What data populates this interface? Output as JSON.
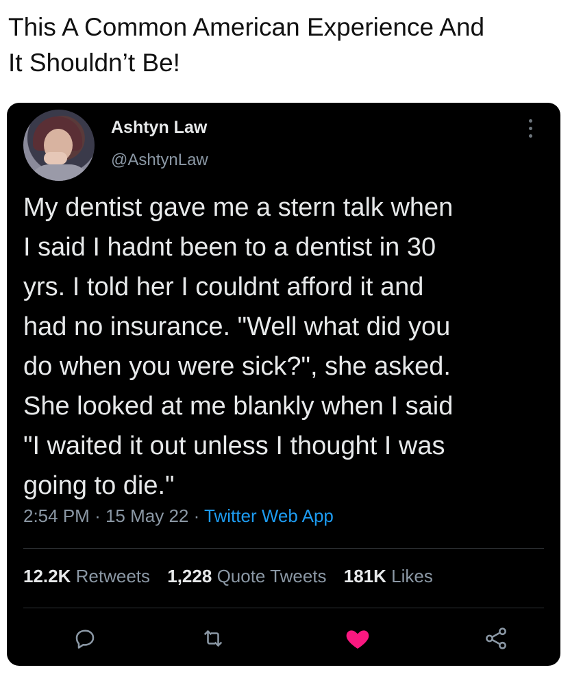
{
  "caption": {
    "line1": "This A Common American Experience And",
    "line2": "It Shouldn’t Be!"
  },
  "tweet": {
    "display_name": "Ashtyn Law",
    "handle": "@AshtynLaw",
    "text": "My dentist gave me a stern talk when\nI said I hadnt been to a dentist in 30\nyrs. I told her I couldnt afford it and\nhad no insurance. \"Well what did you\ndo when you were sick?\", she asked.\nShe looked at me blankly when I said\n\"I waited it out unless I thought I was\ngoing to die.\"",
    "time": "2:54 PM",
    "date": "15 May 22",
    "separator": "·",
    "source": "Twitter Web App"
  },
  "stats": {
    "retweets_count": "12.2K",
    "retweets_label": "Retweets",
    "quotes_count": "1,228",
    "quotes_label": "Quote Tweets",
    "likes_count": "181K",
    "likes_label": "Likes"
  },
  "icons": {
    "reply": "reply-icon",
    "retweet": "retweet-icon",
    "like": "heart-icon",
    "share": "share-icon",
    "more": "more-icon"
  },
  "colors": {
    "card_background": "#000000",
    "primary_text": "#e7e9ea",
    "secondary_text": "#8b98a5",
    "link": "#1d9bf0",
    "like_active": "#f91880"
  }
}
